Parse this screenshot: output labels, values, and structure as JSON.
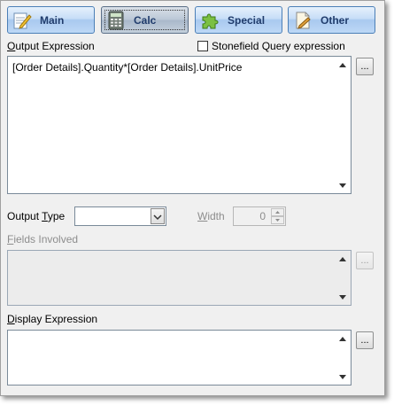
{
  "tabs": [
    {
      "label": "Main",
      "icon": "notepad-pencil-icon"
    },
    {
      "label": "Calc",
      "icon": "calculator-icon",
      "active": true
    },
    {
      "label": "Special",
      "icon": "puzzle-piece-icon"
    },
    {
      "label": "Other",
      "icon": "document-pencil-icon"
    }
  ],
  "output_expression": {
    "label_u": "O",
    "label_rest": "utput Expression",
    "value": "[Order Details].Quantity*[Order Details].UnitPrice",
    "ellipsis": "..."
  },
  "stonefield": {
    "label": "Stonefield Query expression",
    "checked": false
  },
  "output_type": {
    "label_pre": "Output ",
    "label_u": "T",
    "label_post": "ype",
    "value": ""
  },
  "width": {
    "label_u": "W",
    "label_rest": "idth",
    "value": "0"
  },
  "fields_involved": {
    "label_u": "F",
    "label_rest": "ields Involved",
    "ellipsis": "..."
  },
  "display_expression": {
    "label_u": "D",
    "label_rest": "isplay Expression",
    "value": "",
    "ellipsis": "..."
  }
}
